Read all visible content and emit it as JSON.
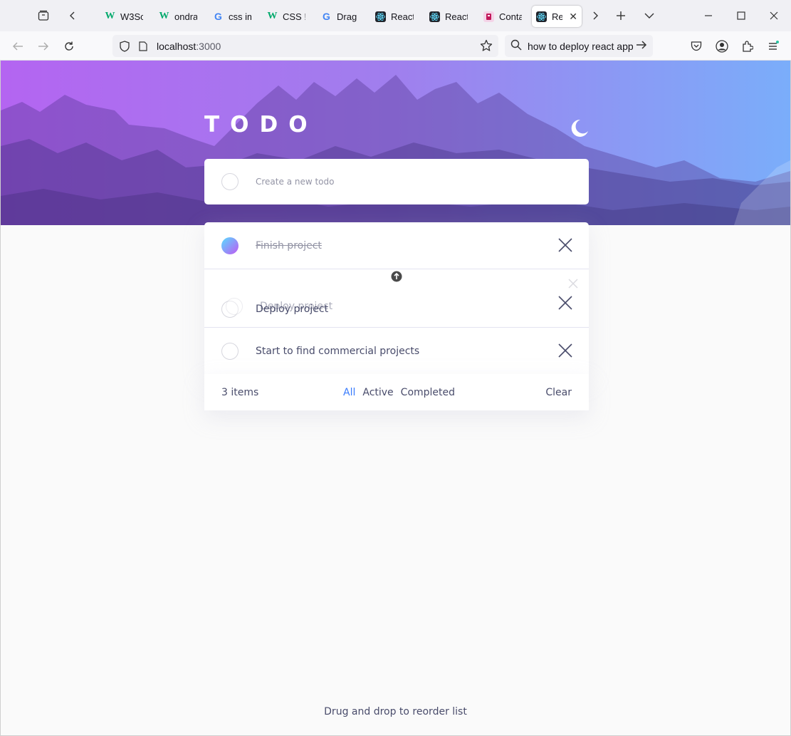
{
  "browser": {
    "tabs": [
      {
        "label": "W3Sc",
        "favicon": "w3schools-icon"
      },
      {
        "label": "ondra",
        "favicon": "w3schools-icon"
      },
      {
        "label": "css im",
        "favicon": "google-icon"
      },
      {
        "label": "CSS !ir",
        "favicon": "w3schools-icon"
      },
      {
        "label": "Drag a",
        "favicon": "google-icon"
      },
      {
        "label": "React",
        "favicon": "react-icon"
      },
      {
        "label": "React",
        "favicon": "react-icon"
      },
      {
        "label": "Conta",
        "favicon": "contact-icon"
      },
      {
        "label": "Rea",
        "favicon": "react-icon",
        "active": true
      }
    ],
    "url": {
      "host": "localhost",
      "port": ":3000"
    },
    "search_query": "how to deploy react app"
  },
  "app": {
    "title": "TODO",
    "new_todo_placeholder": "Create a new todo",
    "todos": [
      {
        "text": "Finish project",
        "completed": true
      },
      {
        "text": "Deploy project",
        "completed": false
      },
      {
        "text": "Start to find commercial projects",
        "completed": false
      }
    ],
    "drag_ghost_text": "Deploy project",
    "items_left": "3 items",
    "filters": [
      "All",
      "Active",
      "Completed"
    ],
    "active_filter": "All",
    "clear_label": "Clear",
    "hint": "Drug and drop to reorder list"
  },
  "colors": {
    "accent": "#3a7cfd",
    "text": "#494c6b",
    "check_gradient_start": "#57ddff",
    "check_gradient_end": "#c058f3"
  }
}
